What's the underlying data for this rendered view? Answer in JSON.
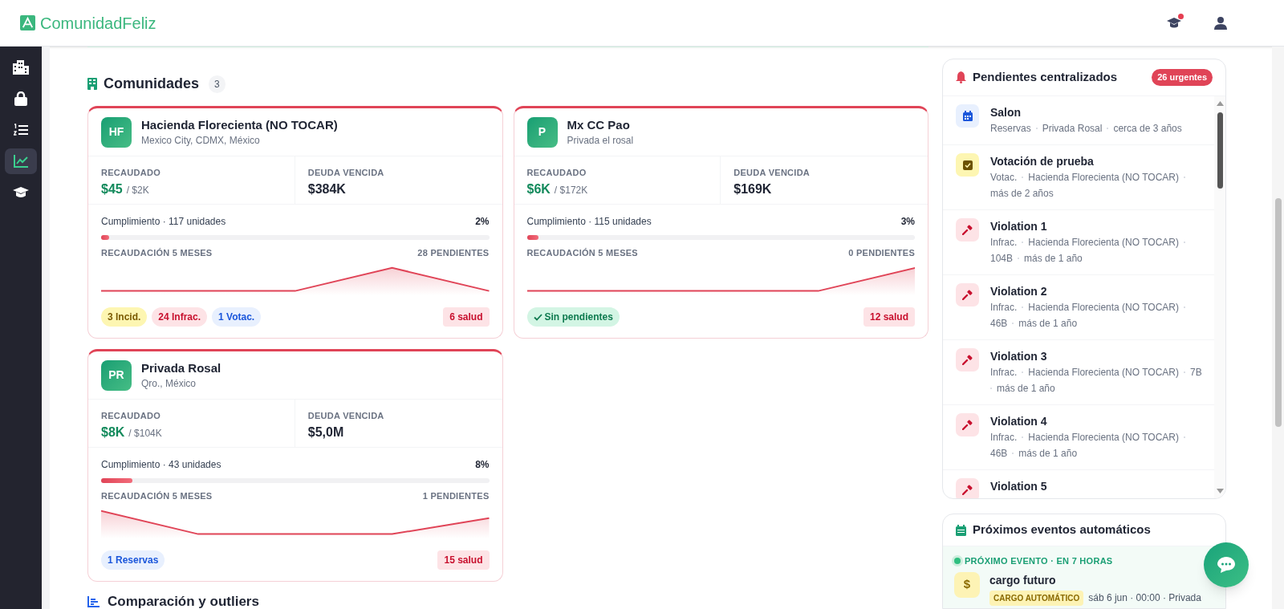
{
  "brand": {
    "name": "ComunidadFeliz"
  },
  "header": {
    "notification_dot": true
  },
  "sidebar": {
    "items": [
      {
        "selected": false
      },
      {
        "selected": false
      },
      {
        "selected": false
      },
      {
        "selected": true
      },
      {
        "selected": false
      }
    ]
  },
  "communities": {
    "title": "Comunidades",
    "count": "3",
    "cards": [
      {
        "initials": "HF",
        "name": "Hacienda Florecienta (NO TOCAR)",
        "location": "Mexico City, CDMX, México",
        "collected_label": "RECAUDADO",
        "collected": "$45",
        "collected_total": "/ $2K",
        "debt_label": "DEUDA VENCIDA",
        "debt": "$384K",
        "compliance": "Cumplimiento · 117 unidades",
        "compliance_pct": "2%",
        "level": 0.02,
        "trend_label": "RECAUDACIÓN 5 MESES",
        "pending": "28 PENDIENTES",
        "tags": [
          {
            "kind": "incid",
            "label": "3 Incid."
          },
          {
            "kind": "infrac",
            "label": "24 Infrac."
          },
          {
            "kind": "votac",
            "label": "1 Votac."
          }
        ],
        "health": "6 salud"
      },
      {
        "initials": "P",
        "name": "Mx CC Pao",
        "location": "Privada el rosal",
        "collected_label": "RECAUDADO",
        "collected": "$6K",
        "collected_total": "/ $172K",
        "debt_label": "DEUDA VENCIDA",
        "debt": "$169K",
        "compliance": "Cumplimiento · 115 unidades",
        "compliance_pct": "3%",
        "level": 0.03,
        "trend_label": "RECAUDACIÓN 5 MESES",
        "pending": "0 PENDIENTES",
        "tags": [
          {
            "kind": "ok",
            "label": "Sin pendientes"
          }
        ],
        "health": "12 salud"
      },
      {
        "initials": "PR",
        "name": "Privada Rosal",
        "location": "Qro., México",
        "collected_label": "RECAUDADO",
        "collected": "$8K",
        "collected_total": "/ $104K",
        "debt_label": "DEUDA VENCIDA",
        "debt": "$5,0M",
        "compliance": "Cumplimiento · 43 unidades",
        "compliance_pct": "8%",
        "level": 0.08,
        "trend_label": "RECAUDACIÓN 5 MESES",
        "pending": "1 PENDIENTES",
        "tags": [
          {
            "kind": "reservas",
            "label": "1 Reservas"
          }
        ],
        "health": "15 salud"
      }
    ]
  },
  "comparison": {
    "title": "Comparación y outliers"
  },
  "pending_panel": {
    "title": "Pendientes centralizados",
    "badge": "26 urgentes",
    "items": [
      {
        "kind": "reserva",
        "title": "Salon",
        "meta": [
          "Reservas",
          "Privada Rosal",
          "cerca de 3 años"
        ]
      },
      {
        "kind": "votacion",
        "title": "Votación de prueba",
        "meta": [
          "Votac.",
          "Hacienda Florecienta (NO TOCAR)",
          "más de 2 años"
        ]
      },
      {
        "kind": "infraccion",
        "title": "Violation 1",
        "meta": [
          "Infrac.",
          "Hacienda Florecienta (NO TOCAR)",
          "104B",
          "más de 1 año"
        ]
      },
      {
        "kind": "infraccion",
        "title": "Violation 2",
        "meta": [
          "Infrac.",
          "Hacienda Florecienta (NO TOCAR)",
          "46B",
          "más de 1 año"
        ]
      },
      {
        "kind": "infraccion",
        "title": "Violation 3",
        "meta": [
          "Infrac.",
          "Hacienda Florecienta (NO TOCAR)",
          "7B",
          "más de 1 año"
        ]
      },
      {
        "kind": "infraccion",
        "title": "Violation 4",
        "meta": [
          "Infrac.",
          "Hacienda Florecienta (NO TOCAR)",
          "46B",
          "más de 1 año"
        ]
      },
      {
        "kind": "infraccion",
        "title": "Violation 5"
      }
    ]
  },
  "events_panel": {
    "title": "Próximos eventos automáticos",
    "next_label": "PRÓXIMO EVENTO · EN 7 HORAS",
    "event": {
      "icon": "$",
      "title": "cargo futuro",
      "badge": "CARGO AUTOMÁTICO",
      "when": "sáb 6 jun · 00:00 · Privada"
    }
  }
}
